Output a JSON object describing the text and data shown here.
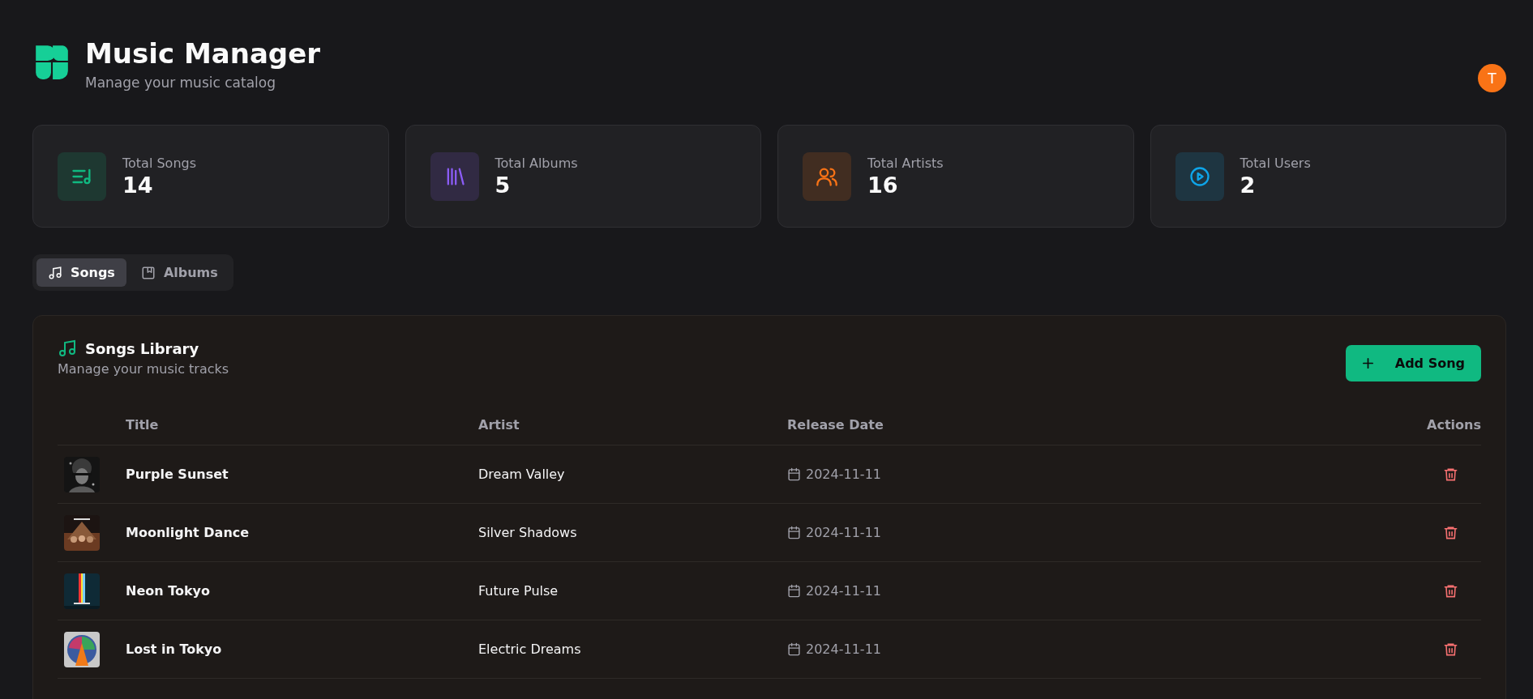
{
  "header": {
    "title": "Music Manager",
    "subtitle": "Manage your music catalog",
    "avatar": "T"
  },
  "stats": [
    {
      "label": "Total Songs",
      "value": "14",
      "color": "#10b981"
    },
    {
      "label": "Total Albums",
      "value": "5",
      "color": "#8b5cf6"
    },
    {
      "label": "Total Artists",
      "value": "16",
      "color": "#f97316"
    },
    {
      "label": "Total Users",
      "value": "2",
      "color": "#0ea5e9"
    }
  ],
  "tabs": [
    {
      "label": "Songs",
      "selected": true
    },
    {
      "label": "Albums",
      "selected": false
    }
  ],
  "library": {
    "title": "Songs Library",
    "subtitle": "Manage your music tracks",
    "add_button": "Add Song",
    "table": {
      "columns": [
        "Title",
        "Artist",
        "Release Date",
        "Actions"
      ],
      "rows": [
        {
          "title": "Purple Sunset",
          "artist": "Dream Valley",
          "release_date": "2024-11-11"
        },
        {
          "title": "Moonlight Dance",
          "artist": "Silver Shadows",
          "release_date": "2024-11-11"
        },
        {
          "title": "Neon Tokyo",
          "artist": "Future Pulse",
          "release_date": "2024-11-11"
        },
        {
          "title": "Lost in Tokyo",
          "artist": "Electric Dreams",
          "release_date": "2024-11-11"
        }
      ]
    }
  }
}
